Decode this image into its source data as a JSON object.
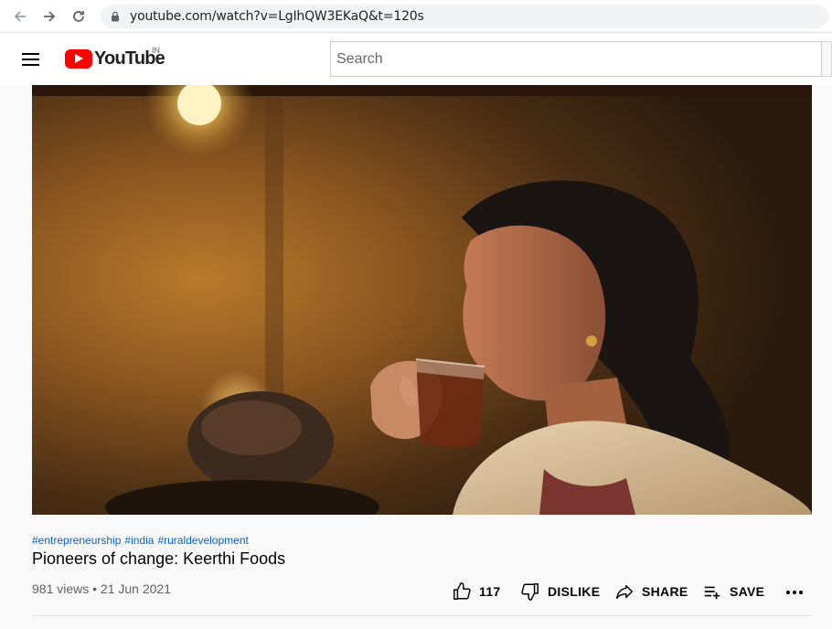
{
  "browser": {
    "url": "youtube.com/watch?v=LgIhQW3EKaQ&t=120s"
  },
  "header": {
    "logo_text": "YouTube",
    "country_code": "IN",
    "search_placeholder": "Search"
  },
  "video": {
    "hashtags": [
      "#entrepreneurship",
      "#india",
      "#ruraldevelopment"
    ],
    "title": "Pioneers of change: Keerthi Foods",
    "views": "981 views",
    "separator": "•",
    "date": "21 Jun 2021",
    "meta_text": "981 views • 21 Jun 2021"
  },
  "actions": {
    "like_count": "117",
    "dislike_label": "DISLIKE",
    "share_label": "SHARE",
    "save_label": "SAVE"
  },
  "icons": {
    "back": "arrow-left-icon",
    "forward": "arrow-right-icon",
    "reload": "reload-icon",
    "lock": "lock-icon",
    "menu": "hamburger-menu-icon",
    "like": "thumbs-up-icon",
    "dislike": "thumbs-down-icon",
    "share": "share-arrow-icon",
    "save": "playlist-add-icon",
    "more": "more-horizontal-icon"
  },
  "colors": {
    "brand_red": "#ff0000",
    "link_blue": "#065fd4",
    "text_primary": "#030303",
    "text_secondary": "#606060"
  }
}
